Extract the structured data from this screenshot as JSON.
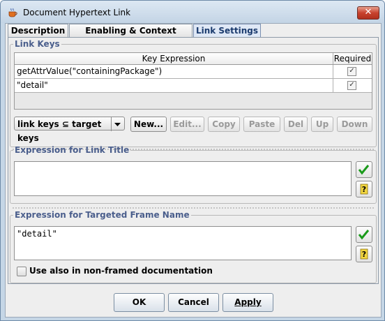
{
  "window": {
    "title": "Document Hypertext Link",
    "close_glyph": "✕"
  },
  "tabs": [
    {
      "label": "Description",
      "active": false
    },
    {
      "label": "Enabling & Context Element",
      "active": false
    },
    {
      "label": "Link Settings",
      "active": true
    }
  ],
  "link_keys": {
    "section_title": "Link Keys",
    "columns": [
      "Key Expression",
      "Required"
    ],
    "rows": [
      {
        "expression": "getAttrValue(\"containingPackage\")",
        "required": true
      },
      {
        "expression": "\"detail\"",
        "required": true
      }
    ],
    "combo_value": "link keys ⊆ target keys",
    "buttons": {
      "new": "New...",
      "edit": "Edit...",
      "copy": "Copy",
      "paste": "Paste",
      "del": "Del",
      "up": "Up",
      "down": "Down"
    }
  },
  "link_title": {
    "section_title": "Expression for Link Title",
    "value": ""
  },
  "frame_name": {
    "section_title": "Expression for Targeted Frame Name",
    "value": "\"detail\"",
    "also_nonframed_label": "Use also in non-framed documentation",
    "also_nonframed_checked": false
  },
  "footer": {
    "ok": "OK",
    "cancel": "Cancel",
    "apply": "Apply"
  },
  "colors": {
    "legend": "#4a5e8c",
    "check_green": "#1a9a1a",
    "help_yellow": "#e8c020"
  },
  "icons": {
    "app": "java-cup-icon",
    "check": "green-check-icon",
    "help": "question-mark-icon"
  }
}
